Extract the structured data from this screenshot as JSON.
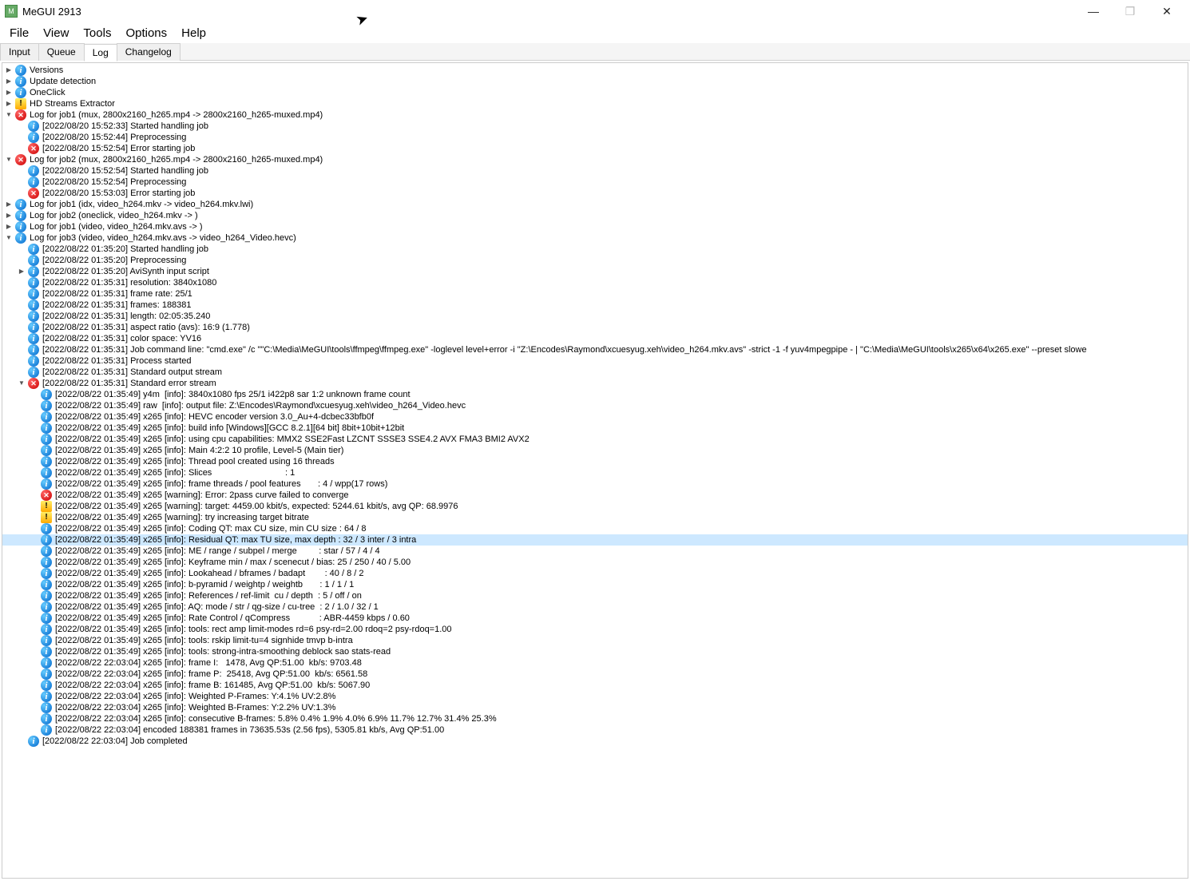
{
  "window": {
    "title": "MeGUI 2913",
    "app_icon_label": "M"
  },
  "win_controls": {
    "min": "—",
    "max": "❐",
    "close": "✕"
  },
  "menu": [
    "File",
    "View",
    "Tools",
    "Options",
    "Help"
  ],
  "tabs": [
    "Input",
    "Queue",
    "Log",
    "Changelog"
  ],
  "active_tab": "Log",
  "selected_index": 42,
  "log": [
    {
      "d": 0,
      "e": "closed",
      "i": "info",
      "t": "Versions"
    },
    {
      "d": 0,
      "e": "closed",
      "i": "info",
      "t": "Update detection"
    },
    {
      "d": 0,
      "e": "closed",
      "i": "info",
      "t": "OneClick"
    },
    {
      "d": 0,
      "e": "closed",
      "i": "warn",
      "t": "HD Streams Extractor"
    },
    {
      "d": 0,
      "e": "open",
      "i": "err",
      "t": "Log for job1 (mux, 2800x2160_h265.mp4 -> 2800x2160_h265-muxed.mp4)"
    },
    {
      "d": 1,
      "e": "none",
      "i": "info",
      "t": "[2022/08/20 15:52:33] Started handling job"
    },
    {
      "d": 1,
      "e": "none",
      "i": "info",
      "t": "[2022/08/20 15:52:44] Preprocessing"
    },
    {
      "d": 1,
      "e": "none",
      "i": "err",
      "t": "[2022/08/20 15:52:54] Error starting job"
    },
    {
      "d": 0,
      "e": "open",
      "i": "err",
      "t": "Log for job2 (mux, 2800x2160_h265.mp4 -> 2800x2160_h265-muxed.mp4)"
    },
    {
      "d": 1,
      "e": "none",
      "i": "info",
      "t": "[2022/08/20 15:52:54] Started handling job"
    },
    {
      "d": 1,
      "e": "none",
      "i": "info",
      "t": "[2022/08/20 15:52:54] Preprocessing"
    },
    {
      "d": 1,
      "e": "none",
      "i": "err",
      "t": "[2022/08/20 15:53:03] Error starting job"
    },
    {
      "d": 0,
      "e": "closed",
      "i": "info",
      "t": "Log for job1 (idx, video_h264.mkv -> video_h264.mkv.lwi)"
    },
    {
      "d": 0,
      "e": "closed",
      "i": "info",
      "t": "Log for job2 (oneclick, video_h264.mkv -> )"
    },
    {
      "d": 0,
      "e": "closed",
      "i": "info",
      "t": "Log for job1 (video, video_h264.mkv.avs -> )"
    },
    {
      "d": 0,
      "e": "open",
      "i": "info",
      "t": "Log for job3 (video, video_h264.mkv.avs -> video_h264_Video.hevc)"
    },
    {
      "d": 1,
      "e": "none",
      "i": "info",
      "t": "[2022/08/22 01:35:20] Started handling job"
    },
    {
      "d": 1,
      "e": "none",
      "i": "info",
      "t": "[2022/08/22 01:35:20] Preprocessing"
    },
    {
      "d": 1,
      "e": "closed",
      "i": "info",
      "t": "[2022/08/22 01:35:20] AviSynth input script"
    },
    {
      "d": 1,
      "e": "none",
      "i": "info",
      "t": "[2022/08/22 01:35:31] resolution: 3840x1080"
    },
    {
      "d": 1,
      "e": "none",
      "i": "info",
      "t": "[2022/08/22 01:35:31] frame rate: 25/1"
    },
    {
      "d": 1,
      "e": "none",
      "i": "info",
      "t": "[2022/08/22 01:35:31] frames: 188381"
    },
    {
      "d": 1,
      "e": "none",
      "i": "info",
      "t": "[2022/08/22 01:35:31] length: 02:05:35.240"
    },
    {
      "d": 1,
      "e": "none",
      "i": "info",
      "t": "[2022/08/22 01:35:31] aspect ratio (avs): 16:9 (1.778)"
    },
    {
      "d": 1,
      "e": "none",
      "i": "info",
      "t": "[2022/08/22 01:35:31] color space: YV16"
    },
    {
      "d": 1,
      "e": "none",
      "i": "info",
      "t": "[2022/08/22 01:35:31] Job command line: \"cmd.exe\" /c \"\"C:\\Media\\MeGUI\\tools\\ffmpeg\\ffmpeg.exe\" -loglevel level+error -i \"Z:\\Encodes\\Raymond\\xcuesyug.xeh\\video_h264.mkv.avs\" -strict -1 -f yuv4mpegpipe - | \"C:\\Media\\MeGUI\\tools\\x265\\x64\\x265.exe\" --preset slowe"
    },
    {
      "d": 1,
      "e": "none",
      "i": "info",
      "t": "[2022/08/22 01:35:31] Process started"
    },
    {
      "d": 1,
      "e": "none",
      "i": "info",
      "t": "[2022/08/22 01:35:31] Standard output stream"
    },
    {
      "d": 1,
      "e": "open",
      "i": "err",
      "t": "[2022/08/22 01:35:31] Standard error stream"
    },
    {
      "d": 2,
      "e": "none",
      "i": "info",
      "t": "[2022/08/22 01:35:49] y4m  [info]: 3840x1080 fps 25/1 i422p8 sar 1:2 unknown frame count"
    },
    {
      "d": 2,
      "e": "none",
      "i": "info",
      "t": "[2022/08/22 01:35:49] raw  [info]: output file: Z:\\Encodes\\Raymond\\xcuesyug.xeh\\video_h264_Video.hevc"
    },
    {
      "d": 2,
      "e": "none",
      "i": "info",
      "t": "[2022/08/22 01:35:49] x265 [info]: HEVC encoder version 3.0_Au+4-dcbec33bfb0f"
    },
    {
      "d": 2,
      "e": "none",
      "i": "info",
      "t": "[2022/08/22 01:35:49] x265 [info]: build info [Windows][GCC 8.2.1][64 bit] 8bit+10bit+12bit"
    },
    {
      "d": 2,
      "e": "none",
      "i": "info",
      "t": "[2022/08/22 01:35:49] x265 [info]: using cpu capabilities: MMX2 SSE2Fast LZCNT SSSE3 SSE4.2 AVX FMA3 BMI2 AVX2"
    },
    {
      "d": 2,
      "e": "none",
      "i": "info",
      "t": "[2022/08/22 01:35:49] x265 [info]: Main 4:2:2 10 profile, Level-5 (Main tier)"
    },
    {
      "d": 2,
      "e": "none",
      "i": "info",
      "t": "[2022/08/22 01:35:49] x265 [info]: Thread pool created using 16 threads"
    },
    {
      "d": 2,
      "e": "none",
      "i": "info",
      "t": "[2022/08/22 01:35:49] x265 [info]: Slices                              : 1"
    },
    {
      "d": 2,
      "e": "none",
      "i": "info",
      "t": "[2022/08/22 01:35:49] x265 [info]: frame threads / pool features       : 4 / wpp(17 rows)"
    },
    {
      "d": 2,
      "e": "none",
      "i": "err",
      "t": "[2022/08/22 01:35:49] x265 [warning]: Error: 2pass curve failed to converge"
    },
    {
      "d": 2,
      "e": "none",
      "i": "warn",
      "t": "[2022/08/22 01:35:49] x265 [warning]: target: 4459.00 kbit/s, expected: 5244.61 kbit/s, avg QP: 68.9976"
    },
    {
      "d": 2,
      "e": "none",
      "i": "warn",
      "t": "[2022/08/22 01:35:49] x265 [warning]: try increasing target bitrate"
    },
    {
      "d": 2,
      "e": "none",
      "i": "info",
      "t": "[2022/08/22 01:35:49] x265 [info]: Coding QT: max CU size, min CU size : 64 / 8"
    },
    {
      "d": 2,
      "e": "none",
      "i": "info",
      "t": "[2022/08/22 01:35:49] x265 [info]: Residual QT: max TU size, max depth : 32 / 3 inter / 3 intra"
    },
    {
      "d": 2,
      "e": "none",
      "i": "info",
      "t": "[2022/08/22 01:35:49] x265 [info]: ME / range / subpel / merge         : star / 57 / 4 / 4"
    },
    {
      "d": 2,
      "e": "none",
      "i": "info",
      "t": "[2022/08/22 01:35:49] x265 [info]: Keyframe min / max / scenecut / bias: 25 / 250 / 40 / 5.00"
    },
    {
      "d": 2,
      "e": "none",
      "i": "info",
      "t": "[2022/08/22 01:35:49] x265 [info]: Lookahead / bframes / badapt        : 40 / 8 / 2"
    },
    {
      "d": 2,
      "e": "none",
      "i": "info",
      "t": "[2022/08/22 01:35:49] x265 [info]: b-pyramid / weightp / weightb       : 1 / 1 / 1"
    },
    {
      "d": 2,
      "e": "none",
      "i": "info",
      "t": "[2022/08/22 01:35:49] x265 [info]: References / ref-limit  cu / depth  : 5 / off / on"
    },
    {
      "d": 2,
      "e": "none",
      "i": "info",
      "t": "[2022/08/22 01:35:49] x265 [info]: AQ: mode / str / qg-size / cu-tree  : 2 / 1.0 / 32 / 1"
    },
    {
      "d": 2,
      "e": "none",
      "i": "info",
      "t": "[2022/08/22 01:35:49] x265 [info]: Rate Control / qCompress            : ABR-4459 kbps / 0.60"
    },
    {
      "d": 2,
      "e": "none",
      "i": "info",
      "t": "[2022/08/22 01:35:49] x265 [info]: tools: rect amp limit-modes rd=6 psy-rd=2.00 rdoq=2 psy-rdoq=1.00"
    },
    {
      "d": 2,
      "e": "none",
      "i": "info",
      "t": "[2022/08/22 01:35:49] x265 [info]: tools: rskip limit-tu=4 signhide tmvp b-intra"
    },
    {
      "d": 2,
      "e": "none",
      "i": "info",
      "t": "[2022/08/22 01:35:49] x265 [info]: tools: strong-intra-smoothing deblock sao stats-read"
    },
    {
      "d": 2,
      "e": "none",
      "i": "info",
      "t": "[2022/08/22 22:03:04] x265 [info]: frame I:   1478, Avg QP:51.00  kb/s: 9703.48"
    },
    {
      "d": 2,
      "e": "none",
      "i": "info",
      "t": "[2022/08/22 22:03:04] x265 [info]: frame P:  25418, Avg QP:51.00  kb/s: 6561.58"
    },
    {
      "d": 2,
      "e": "none",
      "i": "info",
      "t": "[2022/08/22 22:03:04] x265 [info]: frame B: 161485, Avg QP:51.00  kb/s: 5067.90"
    },
    {
      "d": 2,
      "e": "none",
      "i": "info",
      "t": "[2022/08/22 22:03:04] x265 [info]: Weighted P-Frames: Y:4.1% UV:2.8%"
    },
    {
      "d": 2,
      "e": "none",
      "i": "info",
      "t": "[2022/08/22 22:03:04] x265 [info]: Weighted B-Frames: Y:2.2% UV:1.3%"
    },
    {
      "d": 2,
      "e": "none",
      "i": "info",
      "t": "[2022/08/22 22:03:04] x265 [info]: consecutive B-frames: 5.8% 0.4% 1.9% 4.0% 6.9% 11.7% 12.7% 31.4% 25.3%"
    },
    {
      "d": 2,
      "e": "none",
      "i": "info",
      "t": "[2022/08/22 22:03:04] encoded 188381 frames in 73635.53s (2.56 fps), 5305.81 kb/s, Avg QP:51.00"
    },
    {
      "d": 1,
      "e": "none",
      "i": "info",
      "t": "[2022/08/22 22:03:04] Job completed"
    }
  ]
}
